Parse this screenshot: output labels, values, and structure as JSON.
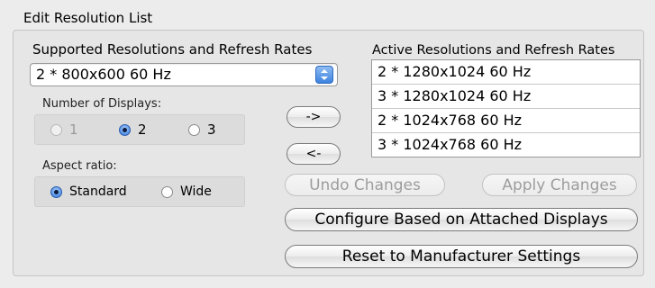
{
  "panel_title": "Edit Resolution List",
  "supported": {
    "label": "Supported Resolutions and Refresh Rates",
    "selected": "2 * 800x600 60 Hz"
  },
  "displays": {
    "label": "Number of Displays:",
    "options": [
      {
        "label": "1",
        "selected": false,
        "enabled": false
      },
      {
        "label": "2",
        "selected": true,
        "enabled": true
      },
      {
        "label": "3",
        "selected": false,
        "enabled": true
      }
    ]
  },
  "aspect": {
    "label": "Aspect ratio:",
    "options": [
      {
        "label": "Standard",
        "selected": true
      },
      {
        "label": "Wide",
        "selected": false
      }
    ]
  },
  "move_buttons": {
    "add": "->",
    "remove": "<-"
  },
  "active": {
    "label": "Active Resolutions and Refresh Rates",
    "items": [
      "2 * 1280x1024 60 Hz",
      "3 * 1280x1024 60 Hz",
      "2 * 1024x768 60 Hz",
      "3 * 1024x768 60 Hz"
    ]
  },
  "buttons": {
    "undo": "Undo Changes",
    "apply": "Apply Changes",
    "configure": "Configure Based on Attached Displays",
    "reset": "Reset to Manufacturer Settings"
  },
  "colors": {
    "accent": "#3d82e0",
    "background": "#ececec"
  }
}
